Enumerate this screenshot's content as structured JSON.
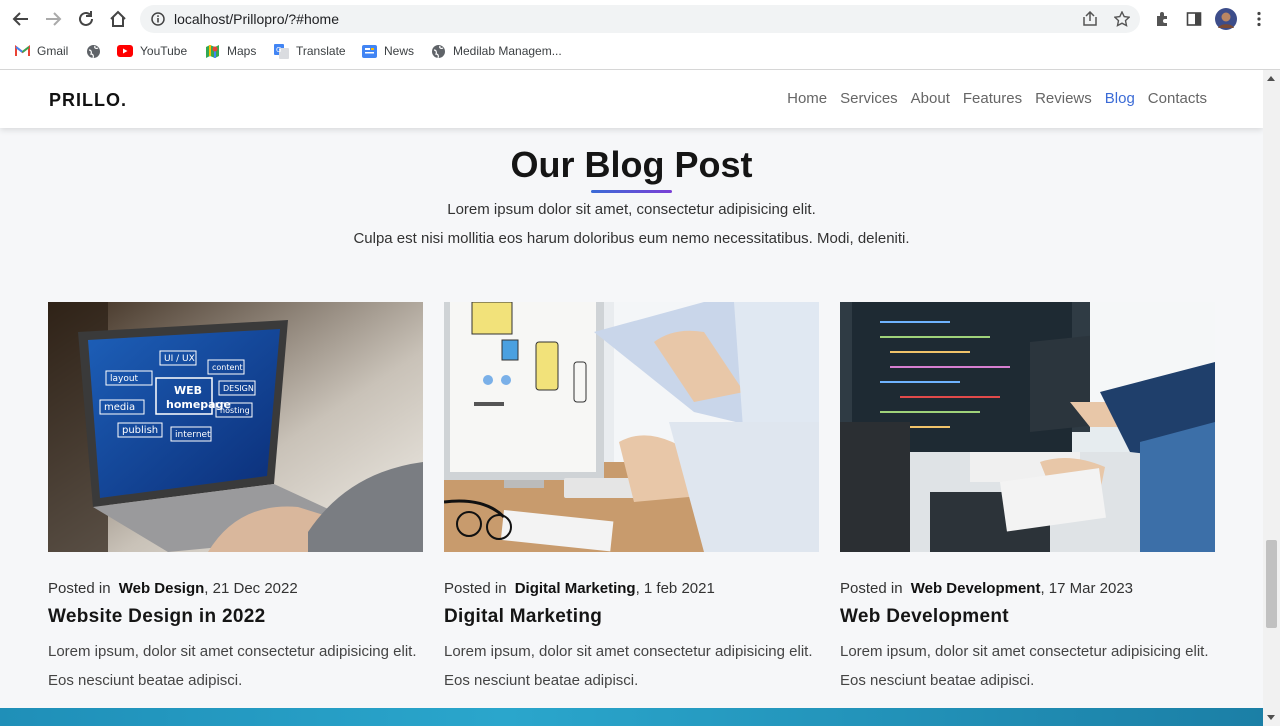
{
  "browser": {
    "url": "localhost/Prillopro/?#home",
    "bookmarks": [
      {
        "label": "Gmail",
        "icon": "gmail-icon"
      },
      {
        "label": "",
        "icon": "globe-icon"
      },
      {
        "label": "YouTube",
        "icon": "youtube-icon"
      },
      {
        "label": "Maps",
        "icon": "maps-icon"
      },
      {
        "label": "Translate",
        "icon": "translate-icon"
      },
      {
        "label": "News",
        "icon": "news-icon"
      },
      {
        "label": "Medilab Managem...",
        "icon": "globe-icon"
      }
    ]
  },
  "site": {
    "logo": "PRILLO.",
    "menu": [
      "Home",
      "Services",
      "About",
      "Features",
      "Reviews",
      "Blog",
      "Contacts"
    ],
    "active_menu": "Blog",
    "accent": "#3b6bd6"
  },
  "blog": {
    "title": "Our Blog Post",
    "subtitle_1": "Lorem ipsum dolor sit amet, consectetur adipisicing elit.",
    "subtitle_2": "Culpa est nisi mollitia eos harum doloribus eum nemo necessitatibus. Modi, deleniti.",
    "posts": [
      {
        "posted_in": "Posted in",
        "category": "Web Design",
        "date": ", 21 Dec 2022",
        "title": "Website Design in 2022",
        "desc": "Lorem ipsum, dolor sit amet consectetur adipisicing elit. Eos nesciunt beatae adipisci.",
        "image_labels": [
          "UI / UX",
          "layout",
          "content",
          "WEB",
          "DESIGN",
          "homepage",
          "media",
          "hosting",
          "publish",
          "internet"
        ]
      },
      {
        "posted_in": "Posted in",
        "category": "Digital Marketing",
        "date": ", 1 feb 2021",
        "title": "Digital Marketing",
        "desc": "Lorem ipsum, dolor sit amet consectetur adipisicing elit. Eos nesciunt beatae adipisci."
      },
      {
        "posted_in": "Posted in",
        "category": "Web Development",
        "date": ", 17 Mar 2023",
        "title": "Web Development",
        "desc": "Lorem ipsum, dolor sit amet consectetur adipisicing elit. Eos nesciunt beatae adipisci."
      }
    ]
  }
}
